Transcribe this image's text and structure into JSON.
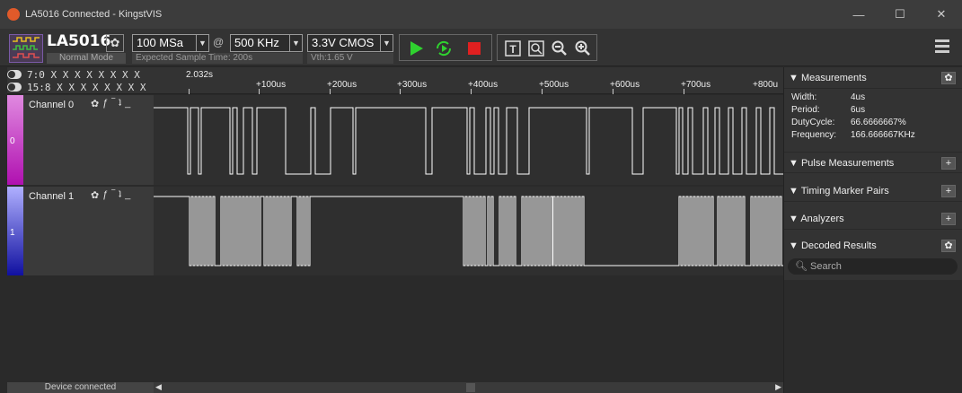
{
  "window": {
    "title": "LA5016 Connected - KingstVIS",
    "min": "—",
    "max": "☐",
    "close": "✕"
  },
  "device": {
    "name": "LA5016",
    "mode": "Normal Mode",
    "sample_rate": "100 MSa",
    "at": "@",
    "sample_depth": "500 KHz",
    "expected": "Expected Sample Time: 200s",
    "voltage": "3.3V CMOS",
    "vth": "Vth:1.65 V"
  },
  "channels_header": {
    "row1": "7:0 X X X X X X X X",
    "row2": "15:8 X X X X X X X X"
  },
  "ruler": {
    "start": "2.032s",
    "ticks": [
      "+100us",
      "+200us",
      "+300us",
      "+400us",
      "+500us",
      "+600us",
      "+700us",
      "+800u"
    ]
  },
  "channels": [
    {
      "name": "Channel 0",
      "index": "0",
      "color": "#c020c0"
    },
    {
      "name": "Channel 1",
      "index": "1",
      "color": "#2020c0"
    }
  ],
  "channel_icons": [
    "✿",
    "ƒ",
    "‾",
    "ʇ",
    "_"
  ],
  "status": "Device connected",
  "panel": {
    "measurements": "▼ Measurements",
    "width_k": "Width:",
    "width_v": "4us",
    "period_k": "Period:",
    "period_v": "6us",
    "duty_k": "DutyCycle:",
    "duty_v": "66.6666667%",
    "freq_k": "Frequency:",
    "freq_v": "166.666667KHz",
    "pulse": "▼ Pulse Measurements",
    "timing": "▼ Timing Marker Pairs",
    "analyzers": "▼ Analyzers",
    "decoded": "▼ Decoded Results",
    "search_placeholder": "Search"
  }
}
